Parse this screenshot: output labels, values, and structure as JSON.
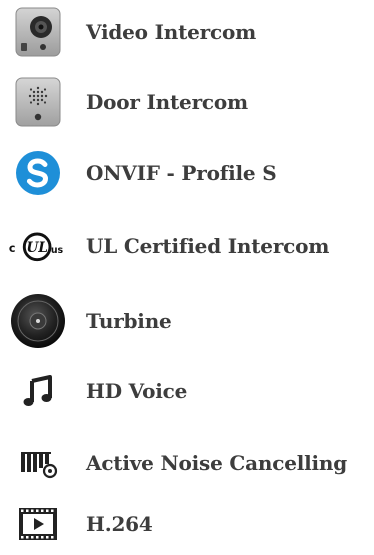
{
  "features": [
    {
      "icon": "video-intercom-device-icon",
      "label": "Video Intercom"
    },
    {
      "icon": "door-intercom-device-icon",
      "label": "Door Intercom"
    },
    {
      "icon": "onvif-profile-s-icon",
      "label": "ONVIF - Profile S"
    },
    {
      "icon": "ul-certified-logo-icon",
      "label": "UL Certified Intercom",
      "logo_text": "c UL us"
    },
    {
      "icon": "turbine-speaker-icon",
      "label": "Turbine"
    },
    {
      "icon": "music-note-icon",
      "label": "HD Voice"
    },
    {
      "icon": "noise-cancelling-icon",
      "label": "Active Noise Cancelling"
    },
    {
      "icon": "video-film-play-icon",
      "label": "H.264"
    }
  ],
  "colors": {
    "label_text": "#3d3d3d",
    "onvif_blue": "#1e8fd8",
    "icon_dark": "#222222",
    "device_gray": "#b9b9b9"
  }
}
